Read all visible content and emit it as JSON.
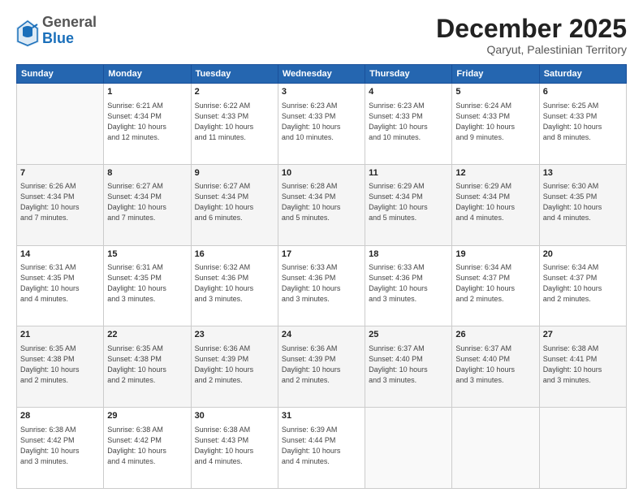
{
  "header": {
    "logo_general": "General",
    "logo_blue": "Blue",
    "month": "December 2025",
    "location": "Qaryut, Palestinian Territory"
  },
  "weekdays": [
    "Sunday",
    "Monday",
    "Tuesday",
    "Wednesday",
    "Thursday",
    "Friday",
    "Saturday"
  ],
  "weeks": [
    [
      {
        "day": "",
        "info": ""
      },
      {
        "day": "1",
        "info": "Sunrise: 6:21 AM\nSunset: 4:34 PM\nDaylight: 10 hours\nand 12 minutes."
      },
      {
        "day": "2",
        "info": "Sunrise: 6:22 AM\nSunset: 4:33 PM\nDaylight: 10 hours\nand 11 minutes."
      },
      {
        "day": "3",
        "info": "Sunrise: 6:23 AM\nSunset: 4:33 PM\nDaylight: 10 hours\nand 10 minutes."
      },
      {
        "day": "4",
        "info": "Sunrise: 6:23 AM\nSunset: 4:33 PM\nDaylight: 10 hours\nand 10 minutes."
      },
      {
        "day": "5",
        "info": "Sunrise: 6:24 AM\nSunset: 4:33 PM\nDaylight: 10 hours\nand 9 minutes."
      },
      {
        "day": "6",
        "info": "Sunrise: 6:25 AM\nSunset: 4:33 PM\nDaylight: 10 hours\nand 8 minutes."
      }
    ],
    [
      {
        "day": "7",
        "info": "Sunrise: 6:26 AM\nSunset: 4:34 PM\nDaylight: 10 hours\nand 7 minutes."
      },
      {
        "day": "8",
        "info": "Sunrise: 6:27 AM\nSunset: 4:34 PM\nDaylight: 10 hours\nand 7 minutes."
      },
      {
        "day": "9",
        "info": "Sunrise: 6:27 AM\nSunset: 4:34 PM\nDaylight: 10 hours\nand 6 minutes."
      },
      {
        "day": "10",
        "info": "Sunrise: 6:28 AM\nSunset: 4:34 PM\nDaylight: 10 hours\nand 5 minutes."
      },
      {
        "day": "11",
        "info": "Sunrise: 6:29 AM\nSunset: 4:34 PM\nDaylight: 10 hours\nand 5 minutes."
      },
      {
        "day": "12",
        "info": "Sunrise: 6:29 AM\nSunset: 4:34 PM\nDaylight: 10 hours\nand 4 minutes."
      },
      {
        "day": "13",
        "info": "Sunrise: 6:30 AM\nSunset: 4:35 PM\nDaylight: 10 hours\nand 4 minutes."
      }
    ],
    [
      {
        "day": "14",
        "info": "Sunrise: 6:31 AM\nSunset: 4:35 PM\nDaylight: 10 hours\nand 4 minutes."
      },
      {
        "day": "15",
        "info": "Sunrise: 6:31 AM\nSunset: 4:35 PM\nDaylight: 10 hours\nand 3 minutes."
      },
      {
        "day": "16",
        "info": "Sunrise: 6:32 AM\nSunset: 4:36 PM\nDaylight: 10 hours\nand 3 minutes."
      },
      {
        "day": "17",
        "info": "Sunrise: 6:33 AM\nSunset: 4:36 PM\nDaylight: 10 hours\nand 3 minutes."
      },
      {
        "day": "18",
        "info": "Sunrise: 6:33 AM\nSunset: 4:36 PM\nDaylight: 10 hours\nand 3 minutes."
      },
      {
        "day": "19",
        "info": "Sunrise: 6:34 AM\nSunset: 4:37 PM\nDaylight: 10 hours\nand 2 minutes."
      },
      {
        "day": "20",
        "info": "Sunrise: 6:34 AM\nSunset: 4:37 PM\nDaylight: 10 hours\nand 2 minutes."
      }
    ],
    [
      {
        "day": "21",
        "info": "Sunrise: 6:35 AM\nSunset: 4:38 PM\nDaylight: 10 hours\nand 2 minutes."
      },
      {
        "day": "22",
        "info": "Sunrise: 6:35 AM\nSunset: 4:38 PM\nDaylight: 10 hours\nand 2 minutes."
      },
      {
        "day": "23",
        "info": "Sunrise: 6:36 AM\nSunset: 4:39 PM\nDaylight: 10 hours\nand 2 minutes."
      },
      {
        "day": "24",
        "info": "Sunrise: 6:36 AM\nSunset: 4:39 PM\nDaylight: 10 hours\nand 2 minutes."
      },
      {
        "day": "25",
        "info": "Sunrise: 6:37 AM\nSunset: 4:40 PM\nDaylight: 10 hours\nand 3 minutes."
      },
      {
        "day": "26",
        "info": "Sunrise: 6:37 AM\nSunset: 4:40 PM\nDaylight: 10 hours\nand 3 minutes."
      },
      {
        "day": "27",
        "info": "Sunrise: 6:38 AM\nSunset: 4:41 PM\nDaylight: 10 hours\nand 3 minutes."
      }
    ],
    [
      {
        "day": "28",
        "info": "Sunrise: 6:38 AM\nSunset: 4:42 PM\nDaylight: 10 hours\nand 3 minutes."
      },
      {
        "day": "29",
        "info": "Sunrise: 6:38 AM\nSunset: 4:42 PM\nDaylight: 10 hours\nand 4 minutes."
      },
      {
        "day": "30",
        "info": "Sunrise: 6:38 AM\nSunset: 4:43 PM\nDaylight: 10 hours\nand 4 minutes."
      },
      {
        "day": "31",
        "info": "Sunrise: 6:39 AM\nSunset: 4:44 PM\nDaylight: 10 hours\nand 4 minutes."
      },
      {
        "day": "",
        "info": ""
      },
      {
        "day": "",
        "info": ""
      },
      {
        "day": "",
        "info": ""
      }
    ]
  ]
}
